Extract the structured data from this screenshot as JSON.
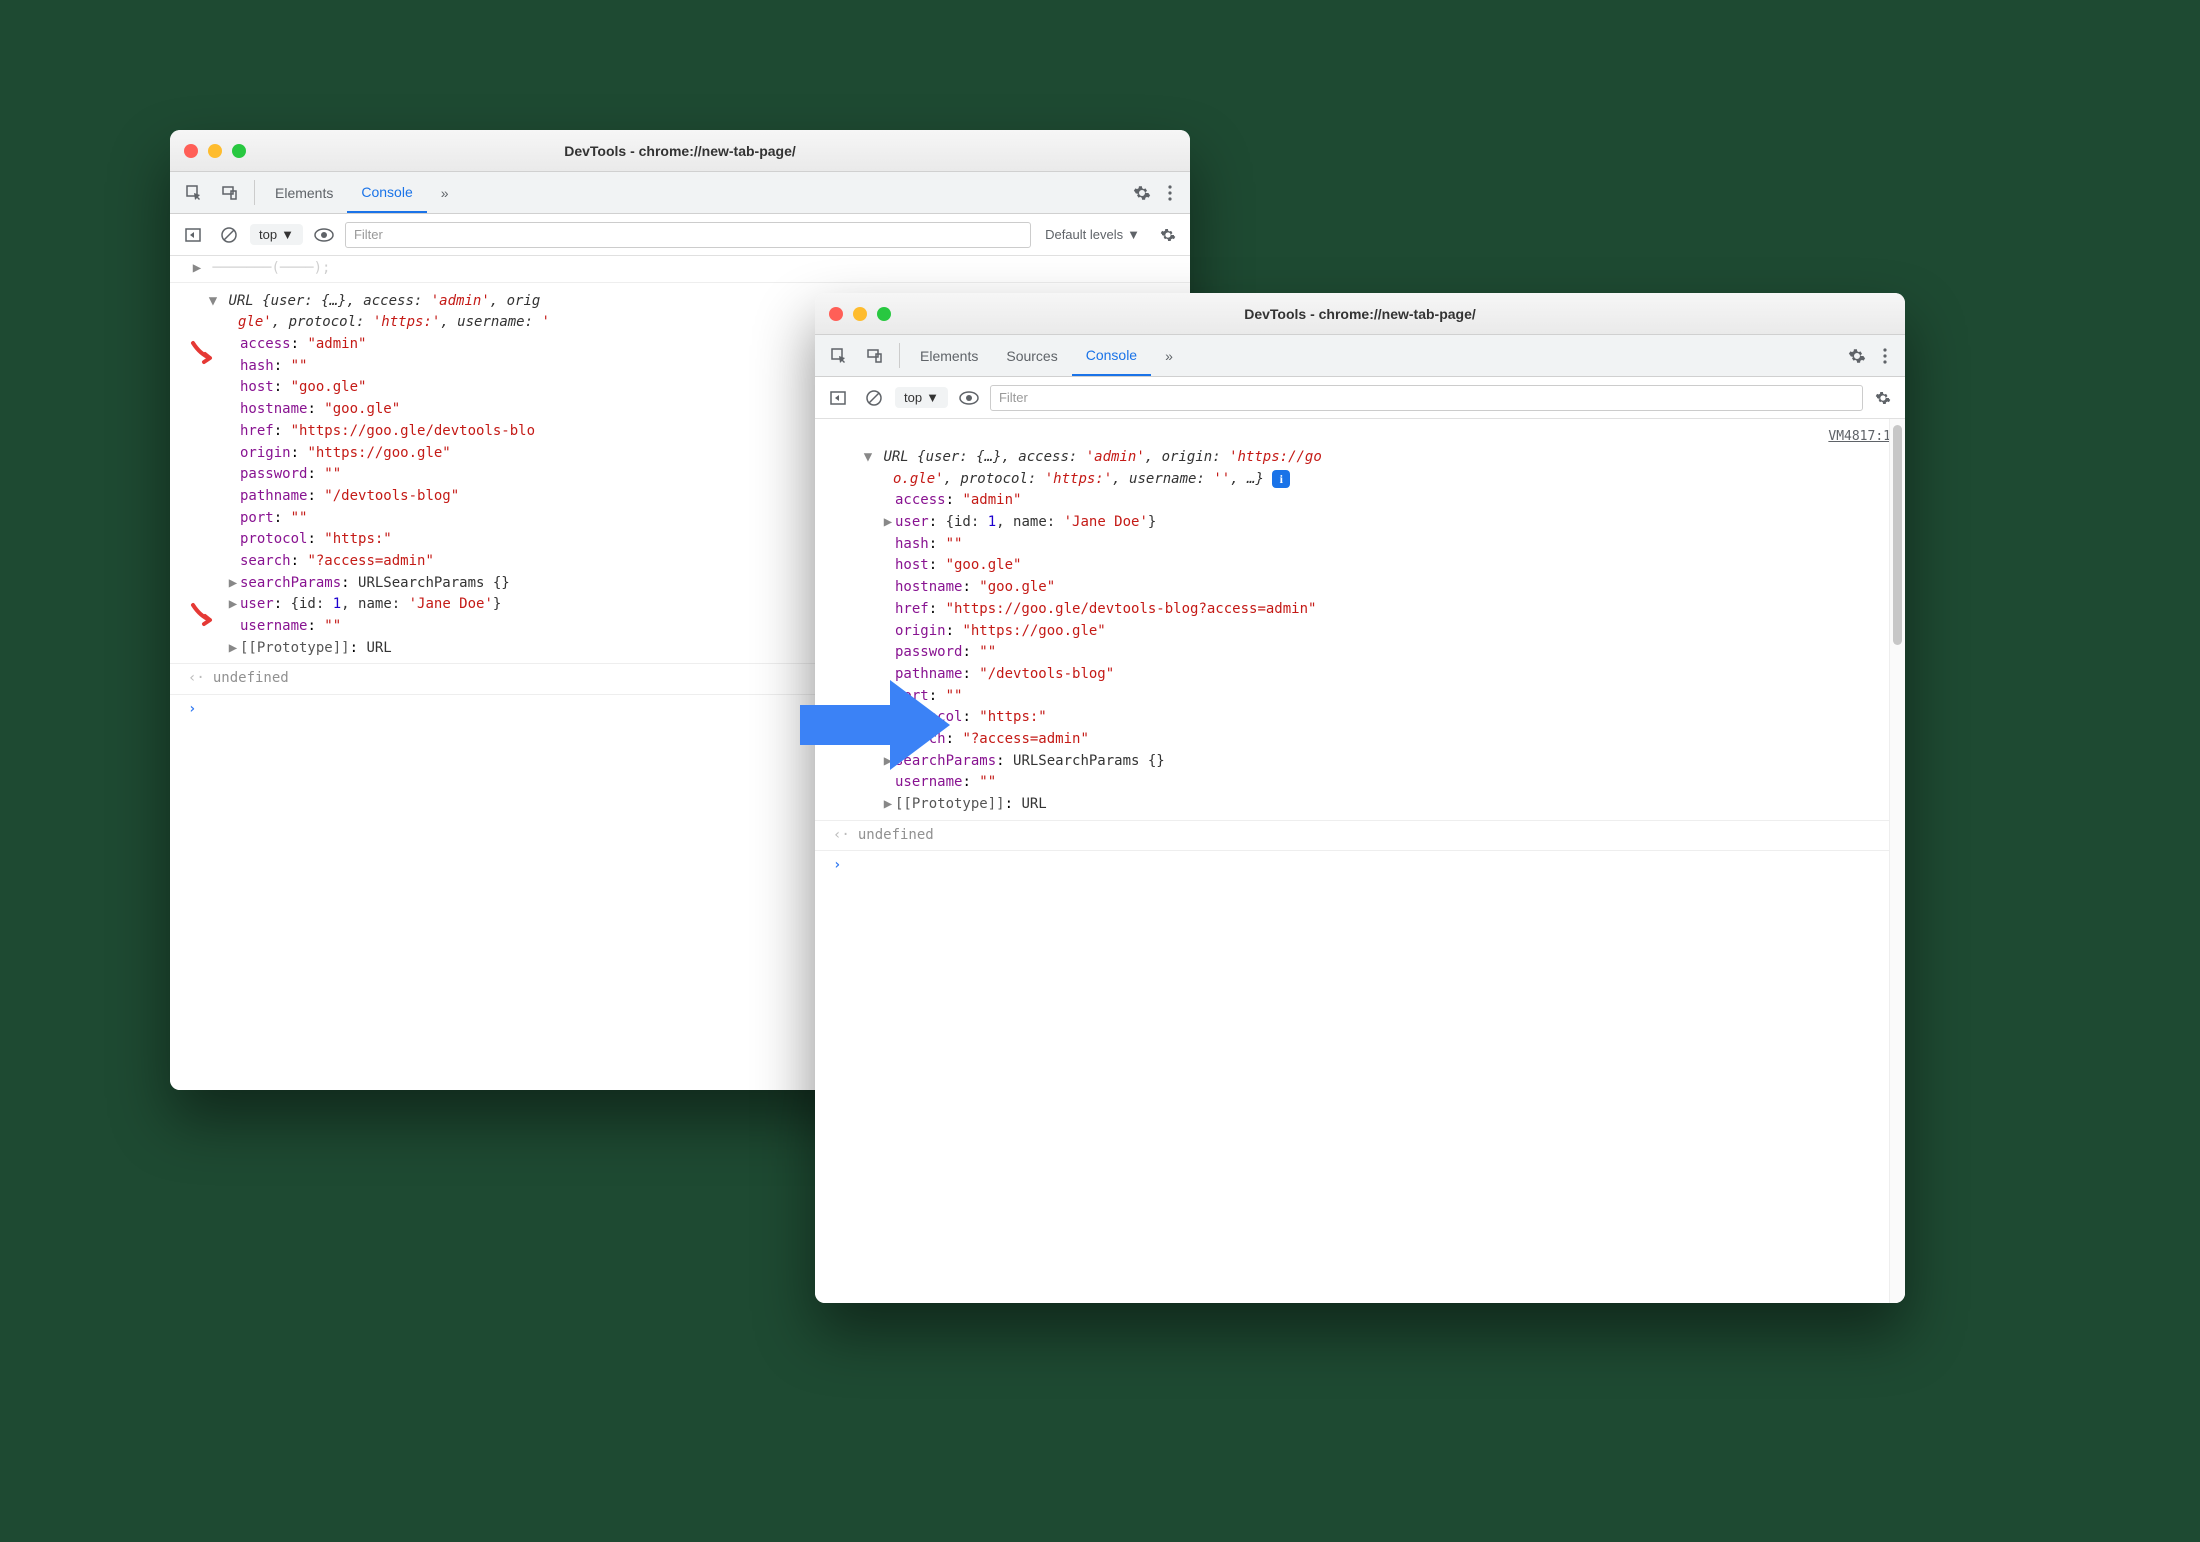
{
  "windows": {
    "left": {
      "title": "DevTools - chrome://new-tab-page/",
      "tabs": [
        "Elements",
        "Console"
      ],
      "activeTab": "Console",
      "overflow": "»",
      "subbar": {
        "context": "top",
        "filter_placeholder": "Filter",
        "levels": "Default levels"
      },
      "cutoff_text": "· · · console.log(· · ·);",
      "summary_prefix": "URL",
      "summary_text_1": " {user: {…}, access: ",
      "summary_access": "'admin'",
      "summary_text_2": ", orig",
      "summary_line2_a": "gle'",
      "summary_line2_b": ", protocol: ",
      "summary_line2_c": "'https:'",
      "summary_line2_d": ", username: ",
      "summary_line2_e": "'",
      "props": [
        {
          "key": "access",
          "val": "\"admin\"",
          "type": "str",
          "expand": "",
          "anno": "red"
        },
        {
          "key": "hash",
          "val": "\"\"",
          "type": "str",
          "expand": ""
        },
        {
          "key": "host",
          "val": "\"goo.gle\"",
          "type": "str",
          "expand": ""
        },
        {
          "key": "hostname",
          "val": "\"goo.gle\"",
          "type": "str",
          "expand": ""
        },
        {
          "key": "href",
          "val": "\"https://goo.gle/devtools-blo",
          "type": "str",
          "expand": ""
        },
        {
          "key": "origin",
          "val": "\"https://goo.gle\"",
          "type": "str",
          "expand": ""
        },
        {
          "key": "password",
          "val": "\"\"",
          "type": "str",
          "expand": ""
        },
        {
          "key": "pathname",
          "val": "\"/devtools-blog\"",
          "type": "str",
          "expand": ""
        },
        {
          "key": "port",
          "val": "\"\"",
          "type": "str",
          "expand": ""
        },
        {
          "key": "protocol",
          "val": "\"https:\"",
          "type": "str",
          "expand": ""
        },
        {
          "key": "search",
          "val": "\"?access=admin\"",
          "type": "str",
          "expand": ""
        },
        {
          "key": "searchParams",
          "val": "URLSearchParams {}",
          "type": "plain",
          "expand": "▶"
        },
        {
          "key": "user",
          "val_pre": "{id: ",
          "val_num": "1",
          "val_mid": ", name: ",
          "val_str": "'Jane Doe'",
          "val_post": "}",
          "type": "obj",
          "expand": "▶",
          "anno": "red"
        },
        {
          "key": "username",
          "val": "\"\"",
          "type": "str",
          "expand": ""
        },
        {
          "key": "[[Prototype]]",
          "val": "URL",
          "type": "proto",
          "expand": "▶"
        }
      ],
      "undefined_label": "undefined"
    },
    "right": {
      "title": "DevTools - chrome://new-tab-page/",
      "tabs": [
        "Elements",
        "Sources",
        "Console"
      ],
      "activeTab": "Console",
      "overflow": "»",
      "subbar": {
        "context": "top",
        "filter_placeholder": "Filter"
      },
      "source_link": "VM4817:1",
      "summary_prefix": "URL",
      "summary_text_1": " {user: {…}, access: ",
      "summary_access": "'admin'",
      "summary_text_2": ", origin: ",
      "summary_origin": "'https://go",
      "summary_line2_a": "o.gle'",
      "summary_line2_b": ", protocol: ",
      "summary_line2_c": "'https:'",
      "summary_line2_d": ", username: ",
      "summary_line2_e": "''",
      "summary_line2_f": ", …}",
      "props": [
        {
          "key": "access",
          "val": "\"admin\"",
          "type": "str",
          "expand": ""
        },
        {
          "key": "user",
          "val_pre": "{id: ",
          "val_num": "1",
          "val_mid": ", name: ",
          "val_str": "'Jane Doe'",
          "val_post": "}",
          "type": "obj",
          "expand": "▶"
        },
        {
          "key": "hash",
          "val": "\"\"",
          "type": "str",
          "expand": ""
        },
        {
          "key": "host",
          "val": "\"goo.gle\"",
          "type": "str",
          "expand": ""
        },
        {
          "key": "hostname",
          "val": "\"goo.gle\"",
          "type": "str",
          "expand": ""
        },
        {
          "key": "href",
          "val": "\"https://goo.gle/devtools-blog?access=admin\"",
          "type": "str",
          "expand": ""
        },
        {
          "key": "origin",
          "val": "\"https://goo.gle\"",
          "type": "str",
          "expand": ""
        },
        {
          "key": "password",
          "val": "\"\"",
          "type": "str",
          "expand": ""
        },
        {
          "key": "pathname",
          "val": "\"/devtools-blog\"",
          "type": "str",
          "expand": ""
        },
        {
          "key": "port",
          "val": "\"\"",
          "type": "str",
          "expand": ""
        },
        {
          "key": "protocol",
          "val": "\"https:\"",
          "type": "str",
          "expand": ""
        },
        {
          "key": "search",
          "val": "\"?access=admin\"",
          "type": "str",
          "expand": ""
        },
        {
          "key": "searchParams",
          "val": "URLSearchParams {}",
          "type": "plain",
          "expand": "▶"
        },
        {
          "key": "username",
          "val": "\"\"",
          "type": "str",
          "expand": ""
        },
        {
          "key": "[[Prototype]]",
          "val": "URL",
          "type": "proto",
          "expand": "▶"
        }
      ],
      "undefined_label": "undefined"
    }
  }
}
